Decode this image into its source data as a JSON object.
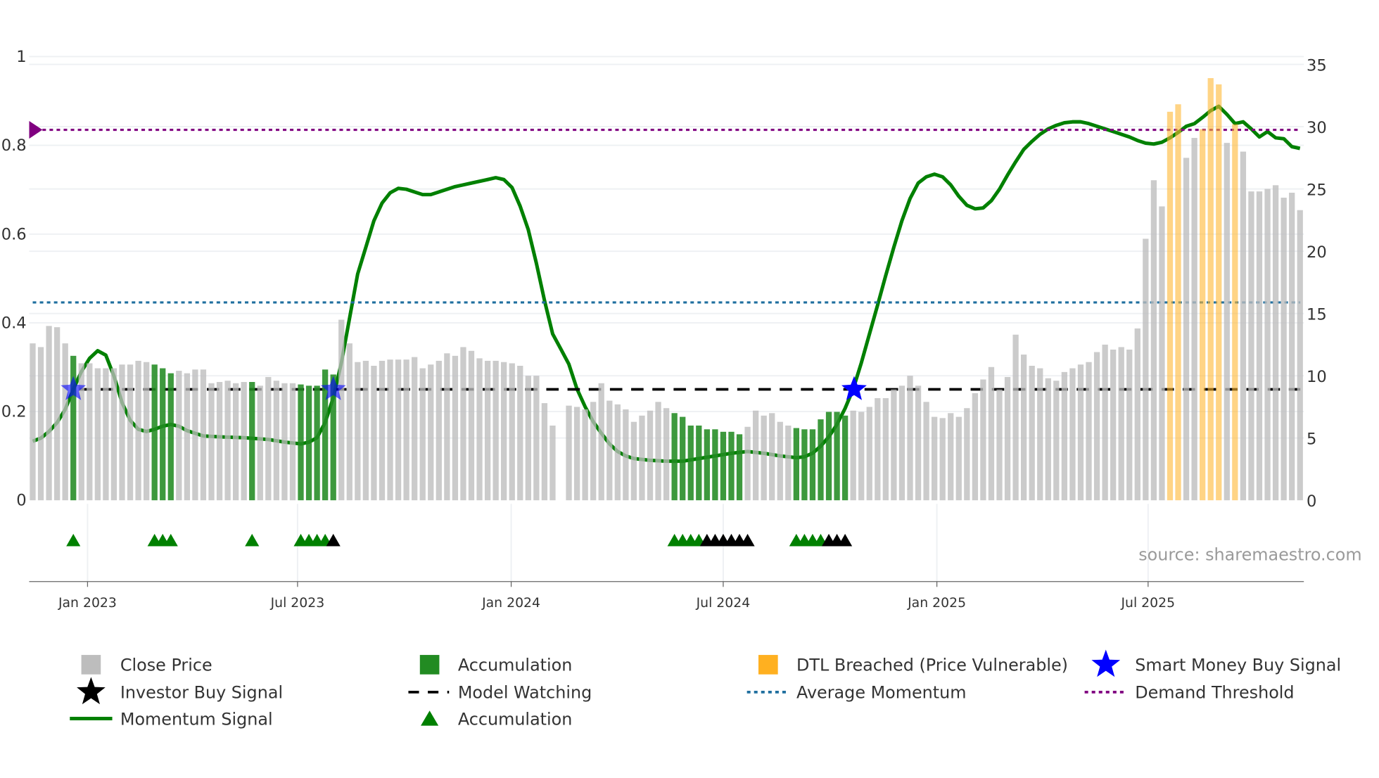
{
  "chart_data": {
    "type": "bar",
    "source_label": "source: sharemaestro.com",
    "left_axis": {
      "ticks": [
        0,
        0.2,
        0.4,
        0.6,
        0.8,
        1
      ],
      "tick_labels": [
        "0",
        "0.2",
        "0.4",
        "0.6",
        "0.8",
        "1"
      ],
      "range": [
        0,
        1
      ]
    },
    "right_axis": {
      "ticks": [
        0,
        5,
        10,
        15,
        20,
        25,
        30,
        35
      ],
      "tick_labels": [
        "0",
        "5",
        "10",
        "15",
        "20",
        "25",
        "30",
        "35"
      ],
      "range": [
        0,
        35
      ]
    },
    "x_axis": {
      "unit": "week index",
      "ticks": [
        {
          "label": "Jan 2023",
          "week": 6.75
        },
        {
          "label": "Jul 2023",
          "week": 32.6
        },
        {
          "label": "Jan 2024",
          "week": 58.9
        },
        {
          "label": "Jul 2024",
          "week": 85.0
        },
        {
          "label": "Jan 2025",
          "week": 111.3
        },
        {
          "label": "Jul 2025",
          "week": 137.3
        }
      ]
    },
    "close_price": [
      12.6,
      12.3,
      14.0,
      13.9,
      12.6,
      11.6,
      11.0,
      11.0,
      10.6,
      10.6,
      10.6,
      10.9,
      10.9,
      11.2,
      11.1,
      10.9,
      10.6,
      10.2,
      10.4,
      10.2,
      10.5,
      10.5,
      9.4,
      9.5,
      9.6,
      9.4,
      9.5,
      9.5,
      9.2,
      9.9,
      9.6,
      9.4,
      9.4,
      9.3,
      9.2,
      9.2,
      10.5,
      10.1,
      14.5,
      12.6,
      11.1,
      11.2,
      10.8,
      11.2,
      11.3,
      11.3,
      11.3,
      11.5,
      10.6,
      10.9,
      11.2,
      11.8,
      11.6,
      12.3,
      12.0,
      11.4,
      11.2,
      11.2,
      11.1,
      11.0,
      10.8,
      10.0,
      10.0,
      7.8,
      6.0,
      null,
      7.6,
      7.5,
      7.3,
      7.9,
      9.4,
      8.0,
      7.7,
      7.3,
      6.3,
      6.8,
      7.2,
      7.9,
      7.4,
      7.0,
      6.7,
      6.0,
      6.0,
      5.7,
      5.7,
      5.5,
      5.5,
      5.3,
      5.9,
      7.2,
      6.8,
      7.0,
      6.3,
      6.0,
      5.8,
      5.7,
      5.7,
      6.5,
      7.1,
      7.1,
      6.8,
      7.2,
      7.1,
      7.5,
      8.2,
      8.2,
      8.9,
      9.2,
      10.0,
      9.2,
      7.9,
      6.7,
      6.6,
      7.0,
      6.7,
      7.4,
      8.6,
      9.7,
      10.7,
      8.9,
      9.9,
      13.3,
      11.7,
      10.8,
      10.6,
      9.8,
      9.6,
      10.3,
      10.6,
      10.9,
      11.1,
      11.9,
      12.5,
      12.1,
      12.3,
      12.1,
      13.8,
      21.0,
      25.7,
      23.6,
      31.2,
      31.8,
      27.5,
      29.1,
      29.8,
      33.9,
      33.4,
      28.7,
      30.2,
      28.0,
      24.8,
      24.8,
      25.0,
      25.3,
      24.3,
      24.7,
      23.3
    ],
    "accumulation_bar_weeks": [
      5,
      15,
      16,
      17,
      27,
      33,
      34,
      35,
      36,
      37,
      79,
      80,
      81,
      82,
      83,
      84,
      85,
      86,
      87,
      94,
      95,
      96,
      97,
      98,
      99,
      100
    ],
    "dtl_breached_weeks": [
      140,
      141,
      144,
      145,
      146,
      148
    ],
    "momentum_signal": [
      [
        0,
        0.133
      ],
      [
        1,
        0.14
      ],
      [
        2,
        0.155
      ],
      [
        3,
        0.175
      ],
      [
        4,
        0.205
      ],
      [
        5,
        0.25
      ],
      [
        6,
        0.29
      ],
      [
        7,
        0.32
      ],
      [
        8,
        0.337
      ],
      [
        9,
        0.327
      ],
      [
        10,
        0.28
      ],
      [
        11,
        0.22
      ],
      [
        12,
        0.18
      ],
      [
        13,
        0.16
      ],
      [
        14,
        0.155
      ],
      [
        15,
        0.16
      ],
      [
        16,
        0.167
      ],
      [
        17,
        0.171
      ],
      [
        18,
        0.167
      ],
      [
        19,
        0.157
      ],
      [
        20,
        0.151
      ],
      [
        21,
        0.145
      ],
      [
        23,
        0.143
      ],
      [
        26,
        0.141
      ],
      [
        29,
        0.137
      ],
      [
        31,
        0.131
      ],
      [
        33,
        0.127
      ],
      [
        34,
        0.131
      ],
      [
        35,
        0.141
      ],
      [
        36,
        0.175
      ],
      [
        37,
        0.231
      ],
      [
        38,
        0.31
      ],
      [
        39,
        0.41
      ],
      [
        40,
        0.51
      ],
      [
        41,
        0.57
      ],
      [
        42,
        0.63
      ],
      [
        43,
        0.67
      ],
      [
        44,
        0.693
      ],
      [
        45,
        0.703
      ],
      [
        46,
        0.701
      ],
      [
        47,
        0.695
      ],
      [
        48,
        0.689
      ],
      [
        49,
        0.689
      ],
      [
        50,
        0.695
      ],
      [
        51,
        0.701
      ],
      [
        52,
        0.707
      ],
      [
        53,
        0.711
      ],
      [
        54,
        0.715
      ],
      [
        55,
        0.719
      ],
      [
        56,
        0.723
      ],
      [
        57,
        0.727
      ],
      [
        58,
        0.723
      ],
      [
        59,
        0.705
      ],
      [
        60,
        0.663
      ],
      [
        61,
        0.61
      ],
      [
        62,
        0.534
      ],
      [
        63,
        0.45
      ],
      [
        64,
        0.375
      ],
      [
        65,
        0.341
      ],
      [
        66,
        0.307
      ],
      [
        67,
        0.251
      ],
      [
        68,
        0.211
      ],
      [
        69,
        0.177
      ],
      [
        70,
        0.151
      ],
      [
        71,
        0.127
      ],
      [
        72,
        0.11
      ],
      [
        73,
        0.1
      ],
      [
        74,
        0.094
      ],
      [
        76,
        0.09
      ],
      [
        78,
        0.088
      ],
      [
        80,
        0.088
      ],
      [
        82,
        0.094
      ],
      [
        84,
        0.1
      ],
      [
        86,
        0.106
      ],
      [
        88,
        0.11
      ],
      [
        90,
        0.106
      ],
      [
        92,
        0.1
      ],
      [
        94,
        0.096
      ],
      [
        95,
        0.098
      ],
      [
        96,
        0.106
      ],
      [
        97,
        0.122
      ],
      [
        98,
        0.143
      ],
      [
        99,
        0.171
      ],
      [
        100,
        0.207
      ],
      [
        101,
        0.251
      ],
      [
        102,
        0.31
      ],
      [
        103,
        0.375
      ],
      [
        104,
        0.44
      ],
      [
        105,
        0.506
      ],
      [
        106,
        0.57
      ],
      [
        107,
        0.63
      ],
      [
        108,
        0.68
      ],
      [
        109,
        0.715
      ],
      [
        110,
        0.729
      ],
      [
        111,
        0.735
      ],
      [
        112,
        0.729
      ],
      [
        113,
        0.711
      ],
      [
        114,
        0.685
      ],
      [
        115,
        0.665
      ],
      [
        116,
        0.657
      ],
      [
        117,
        0.659
      ],
      [
        118,
        0.675
      ],
      [
        119,
        0.701
      ],
      [
        120,
        0.733
      ],
      [
        121,
        0.763
      ],
      [
        122,
        0.791
      ],
      [
        123,
        0.809
      ],
      [
        124,
        0.825
      ],
      [
        125,
        0.837
      ],
      [
        126,
        0.845
      ],
      [
        127,
        0.851
      ],
      [
        128,
        0.853
      ],
      [
        129,
        0.853
      ],
      [
        130,
        0.849
      ],
      [
        131,
        0.843
      ],
      [
        132,
        0.837
      ],
      [
        133,
        0.831
      ],
      [
        134,
        0.825
      ],
      [
        135,
        0.819
      ],
      [
        136,
        0.811
      ],
      [
        137,
        0.805
      ],
      [
        138,
        0.803
      ],
      [
        139,
        0.807
      ],
      [
        140,
        0.817
      ],
      [
        141,
        0.829
      ],
      [
        142,
        0.843
      ],
      [
        143,
        0.849
      ],
      [
        144,
        0.863
      ],
      [
        145,
        0.878
      ],
      [
        146,
        0.888
      ],
      [
        147,
        0.87
      ],
      [
        148,
        0.849
      ],
      [
        149,
        0.853
      ],
      [
        150,
        0.837
      ],
      [
        151,
        0.819
      ],
      [
        152,
        0.831
      ],
      [
        153,
        0.817
      ],
      [
        154,
        0.815
      ],
      [
        155,
        0.797
      ],
      [
        156,
        0.793
      ]
    ],
    "model_watching_level": 0.25,
    "average_momentum_level": 0.446,
    "demand_threshold_level": 0.835,
    "smart_money_buy_weeks": [
      5,
      37,
      101
    ],
    "accumulation_triangle_weeks": [
      5,
      15,
      16,
      17,
      27,
      33,
      34,
      35,
      36,
      79,
      80,
      81,
      82,
      94,
      95,
      96,
      97
    ],
    "investor_buy_triangle_weeks": [
      37,
      83,
      84,
      85,
      86,
      87,
      88,
      98,
      99,
      100
    ],
    "colors": {
      "close": "#bdbdbd",
      "accum": "#228b22",
      "dtl": "#ffb733",
      "momentum": "#008000",
      "avg": "#1f6f9f",
      "demand": "#800080",
      "smart": "#0000ff",
      "investor": "#000000"
    },
    "legend": [
      {
        "label": "Close Price",
        "icon": "gray-square"
      },
      {
        "label": "Accumulation",
        "icon": "green-square"
      },
      {
        "label": "DTL Breached (Price Vulnerable)",
        "icon": "orange-square"
      },
      {
        "label": "Smart Money Buy Signal",
        "icon": "blue-star"
      },
      {
        "label": "Investor Buy Signal",
        "icon": "black-star"
      },
      {
        "label": "Model Watching",
        "icon": "black-dash"
      },
      {
        "label": "Average Momentum",
        "icon": "blue-dots"
      },
      {
        "label": "Demand Threshold",
        "icon": "purple-dots"
      },
      {
        "label": "Momentum Signal",
        "icon": "green-line"
      },
      {
        "label": "Accumulation",
        "icon": "green-triangle"
      }
    ]
  }
}
